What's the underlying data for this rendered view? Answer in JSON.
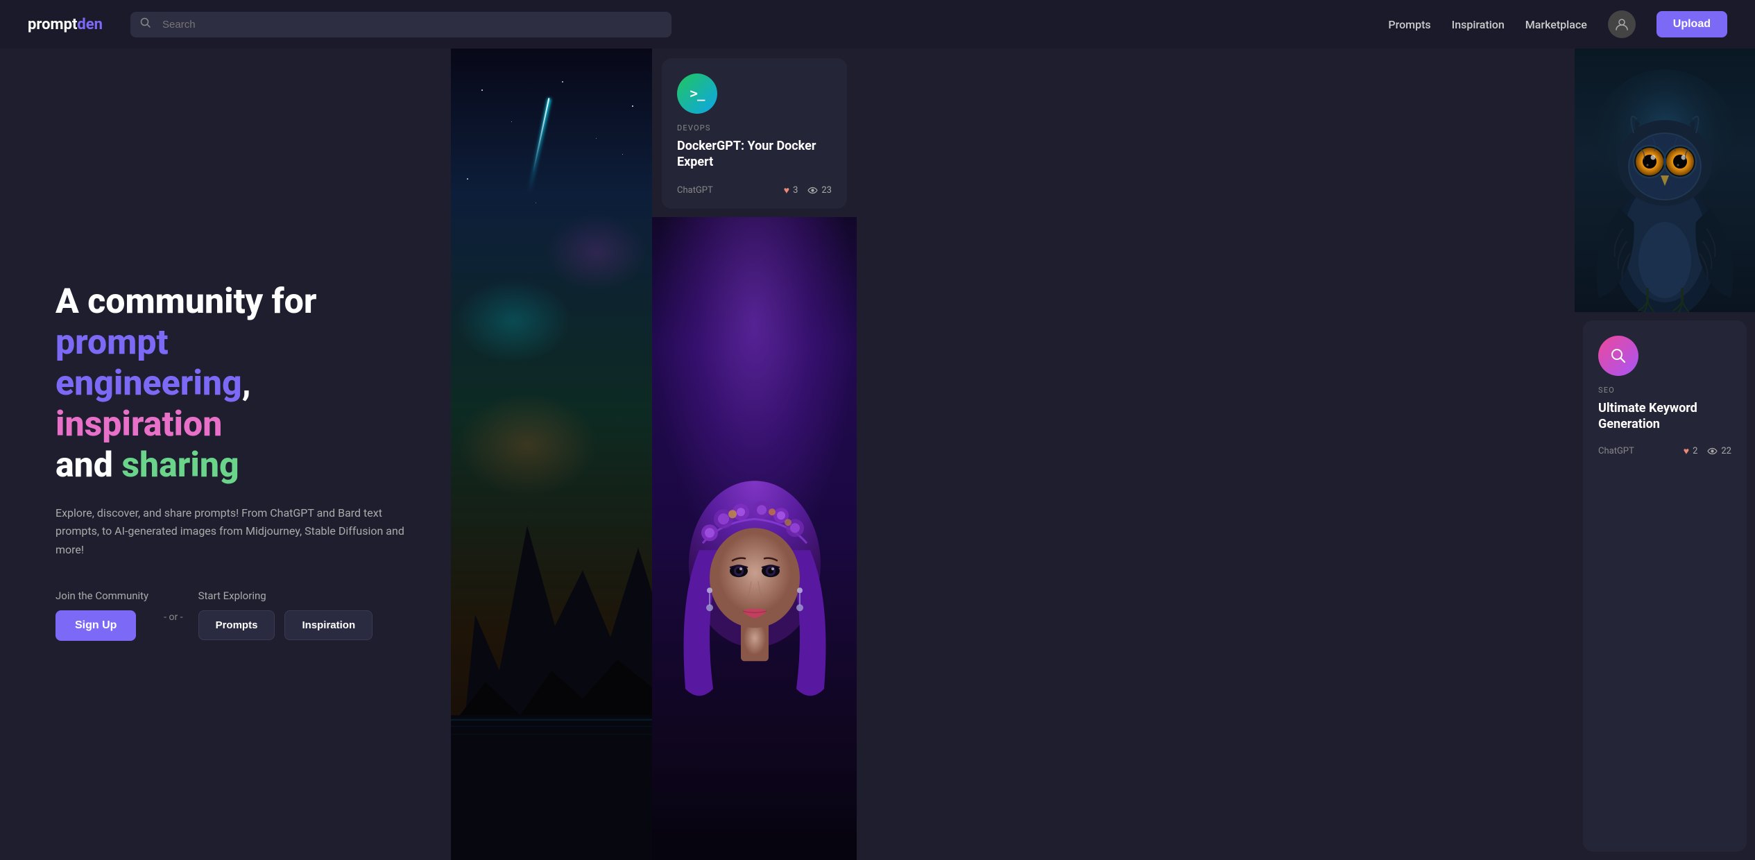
{
  "logo": {
    "prompt": "prompt",
    "den": "den"
  },
  "search": {
    "placeholder": "Search"
  },
  "nav": {
    "prompts": "Prompts",
    "inspiration": "Inspiration",
    "marketplace": "Marketplace",
    "upload": "Upload"
  },
  "hero": {
    "line1_before": "A community for ",
    "line1_colored": "prompt",
    "line2_colored": "engineering",
    "line2_separator": ", ",
    "line2_pink": "inspiration",
    "line3_before": "and ",
    "line3_green": "sharing",
    "description": "Explore, discover, and share prompts! From ChatGPT and Bard text prompts, to AI-generated images from Midjourney, Stable Diffusion and more!",
    "join_label": "Join the Community",
    "signup_label": "Sign Up",
    "or_label": "- or -",
    "explore_label": "Start Exploring",
    "prompts_btn": "Prompts",
    "inspiration_btn": "Inspiration"
  },
  "cards": {
    "docker": {
      "tag": "DEVOPS",
      "title": "DockerGPT: Your Docker Expert",
      "platform": "ChatGPT",
      "likes": "3",
      "views": "23"
    },
    "seo": {
      "tag": "SEO",
      "title": "Ultimate Keyword Generation",
      "platform": "ChatGPT",
      "likes": "2",
      "views": "22"
    }
  },
  "icons": {
    "search": "🔍",
    "user": "👤",
    "terminal": ">_",
    "magnify": "🔍",
    "heart": "♥",
    "eye": "👁"
  }
}
